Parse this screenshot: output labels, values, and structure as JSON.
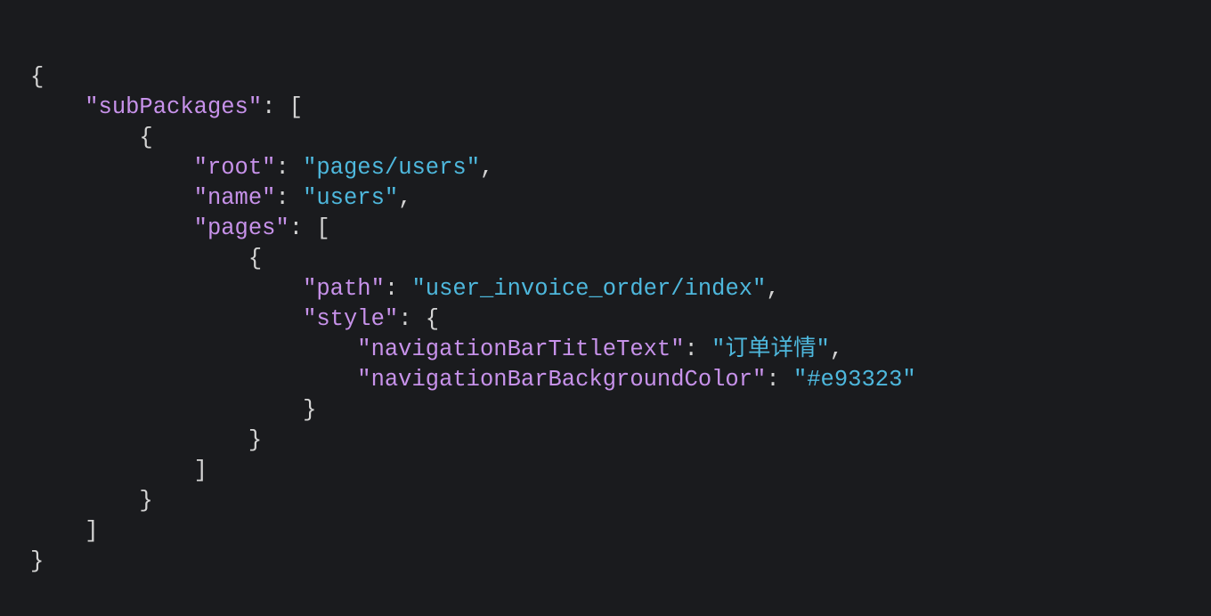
{
  "editor": {
    "language": "json",
    "background_color": "#1a1b1e",
    "colors": {
      "punctuation": "#d4d4d4",
      "key": "#c792ea",
      "string": "#4eb8dd"
    }
  },
  "code": {
    "lines": [
      {
        "indent": 0,
        "tokens": [
          {
            "type": "punct",
            "text": "{"
          }
        ]
      },
      {
        "indent": 4,
        "tokens": [
          {
            "type": "key",
            "text": "\"subPackages\""
          },
          {
            "type": "punct",
            "text": ": ["
          }
        ]
      },
      {
        "indent": 8,
        "tokens": [
          {
            "type": "punct",
            "text": "{"
          }
        ]
      },
      {
        "indent": 12,
        "tokens": [
          {
            "type": "key",
            "text": "\"root\""
          },
          {
            "type": "punct",
            "text": ": "
          },
          {
            "type": "string",
            "text": "\"pages/users\""
          },
          {
            "type": "punct",
            "text": ","
          }
        ]
      },
      {
        "indent": 12,
        "tokens": [
          {
            "type": "key",
            "text": "\"name\""
          },
          {
            "type": "punct",
            "text": ": "
          },
          {
            "type": "string",
            "text": "\"users\""
          },
          {
            "type": "punct",
            "text": ","
          }
        ]
      },
      {
        "indent": 12,
        "tokens": [
          {
            "type": "key",
            "text": "\"pages\""
          },
          {
            "type": "punct",
            "text": ": ["
          }
        ]
      },
      {
        "indent": 16,
        "tokens": [
          {
            "type": "punct",
            "text": "{"
          }
        ]
      },
      {
        "indent": 20,
        "tokens": [
          {
            "type": "key",
            "text": "\"path\""
          },
          {
            "type": "punct",
            "text": ": "
          },
          {
            "type": "string",
            "text": "\"user_invoice_order/index\""
          },
          {
            "type": "punct",
            "text": ","
          }
        ]
      },
      {
        "indent": 20,
        "tokens": [
          {
            "type": "key",
            "text": "\"style\""
          },
          {
            "type": "punct",
            "text": ": {"
          }
        ]
      },
      {
        "indent": 24,
        "tokens": [
          {
            "type": "key",
            "text": "\"navigationBarTitleText\""
          },
          {
            "type": "punct",
            "text": ": "
          },
          {
            "type": "string",
            "text": "\"订单详情\""
          },
          {
            "type": "punct",
            "text": ","
          }
        ]
      },
      {
        "indent": 24,
        "tokens": [
          {
            "type": "key",
            "text": "\"navigationBarBackgroundColor\""
          },
          {
            "type": "punct",
            "text": ": "
          },
          {
            "type": "string",
            "text": "\"#e93323\""
          }
        ]
      },
      {
        "indent": 20,
        "tokens": [
          {
            "type": "punct",
            "text": "}"
          }
        ]
      },
      {
        "indent": 16,
        "tokens": [
          {
            "type": "punct",
            "text": "}"
          }
        ]
      },
      {
        "indent": 12,
        "tokens": [
          {
            "type": "punct",
            "text": "]"
          }
        ]
      },
      {
        "indent": 8,
        "tokens": [
          {
            "type": "punct",
            "text": "}"
          }
        ]
      },
      {
        "indent": 4,
        "tokens": [
          {
            "type": "punct",
            "text": "]"
          }
        ]
      },
      {
        "indent": 0,
        "tokens": [
          {
            "type": "punct",
            "text": "}"
          }
        ]
      }
    ]
  }
}
